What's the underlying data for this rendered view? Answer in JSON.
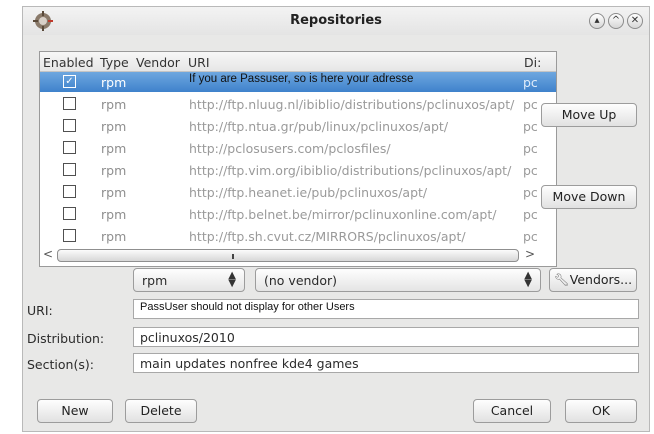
{
  "window": {
    "title": "Repositories"
  },
  "table": {
    "headers": [
      "Enabled",
      "Type",
      "Vendor",
      "URI",
      "Di:"
    ],
    "rows": [
      {
        "enabled": true,
        "type": "rpm",
        "uri": "If you are Passuser, so is here your adresse",
        "dist": "pc"
      },
      {
        "enabled": false,
        "type": "rpm",
        "uri": "http://ftp.nluug.nl/ibiblio/distributions/pclinuxos/apt/",
        "dist": "pc"
      },
      {
        "enabled": false,
        "type": "rpm",
        "uri": "http://ftp.ntua.gr/pub/linux/pclinuxos/apt/",
        "dist": "pc"
      },
      {
        "enabled": false,
        "type": "rpm",
        "uri": "http://pclosusers.com/pclosfiles/",
        "dist": "pc"
      },
      {
        "enabled": false,
        "type": "rpm",
        "uri": "http://ftp.vim.org/ibiblio/distributions/pclinuxos/apt/",
        "dist": "pc"
      },
      {
        "enabled": false,
        "type": "rpm",
        "uri": "http://ftp.heanet.ie/pub/pclinuxos/apt/",
        "dist": "pc"
      },
      {
        "enabled": false,
        "type": "rpm",
        "uri": "http://ftp.belnet.be/mirror/pclinuxonline.com/apt/",
        "dist": "pc"
      },
      {
        "enabled": false,
        "type": "rpm",
        "uri": "http://ftp.sh.cvut.cz/MIRRORS/pclinuxos/apt/",
        "dist": "pc"
      }
    ]
  },
  "buttons": {
    "move_up": "Move Up",
    "move_down": "Move Down",
    "vendors": "Vendors...",
    "new": "New",
    "delete": "Delete",
    "cancel": "Cancel",
    "ok": "OK"
  },
  "editor": {
    "type_value": "rpm",
    "vendor_value": "(no vendor)",
    "uri_label": "URI:",
    "uri_value": "PassUser should not display for other Users",
    "distribution_label": "Distribution:",
    "distribution_value": "pclinuxos/2010",
    "sections_label": "Section(s):",
    "sections_value": "main updates nonfree kde4 games"
  },
  "colors": {
    "selection": "#4a8bd2",
    "window_bg": "#e8e8e7"
  },
  "icons": [
    "app-icon",
    "help-icon",
    "minimize-icon",
    "close-icon",
    "wrench-icon",
    "scroll-left-icon",
    "scroll-right-icon"
  ]
}
